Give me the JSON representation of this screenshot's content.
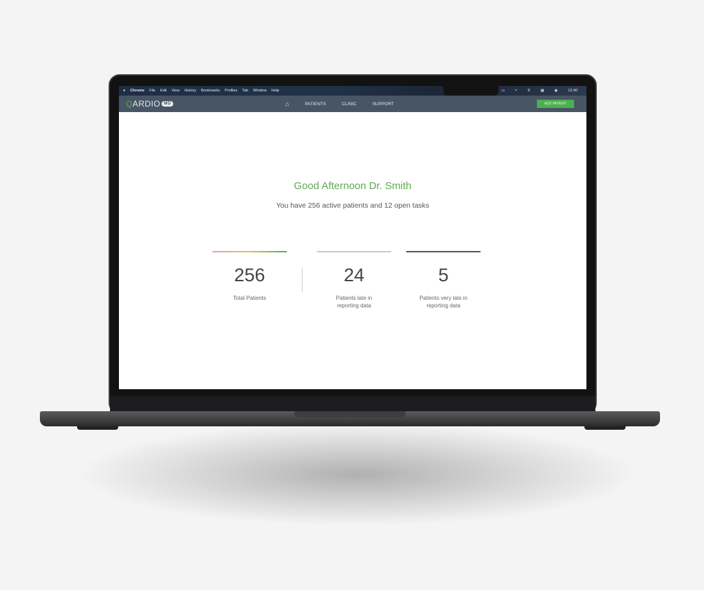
{
  "menubar": {
    "app": "Chrome",
    "items": [
      "File",
      "Edit",
      "View",
      "History",
      "Bookmarks",
      "Profiles",
      "Tab",
      "Window",
      "Help"
    ],
    "time": "12:40"
  },
  "nav": {
    "logo_q": "Q",
    "logo_rest": "ARDIO",
    "logo_badge": "MD",
    "links": [
      "PATIENTS",
      "CLINIC",
      "SUPPORT"
    ],
    "add_patient": "ADD PATIENT"
  },
  "main": {
    "greeting": "Good Afternoon Dr. Smith",
    "subtitle": "You have 256 active patients and 12 open tasks",
    "stats": [
      {
        "value": "256",
        "label": "Total Patients",
        "color": "gradient pink-yellow-green"
      },
      {
        "value": "24",
        "label": "Patients late in reporting data",
        "color": "#c8c8c8"
      },
      {
        "value": "5",
        "label": "Patients very late in reporting data",
        "color": "#555555"
      }
    ]
  },
  "colors": {
    "accent": "#4caf50",
    "nav": "#485564"
  }
}
